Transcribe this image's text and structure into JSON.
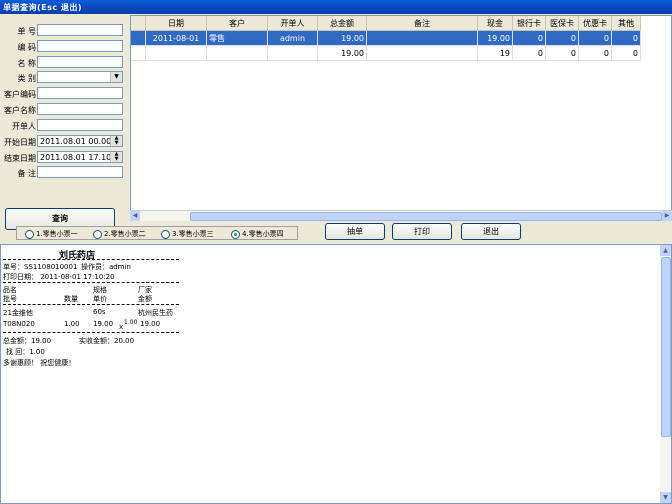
{
  "window": {
    "title": "单据查询(Esc 退出)"
  },
  "filters": {
    "fields": [
      {
        "label": "单 号",
        "value": ""
      },
      {
        "label": "编 码",
        "value": ""
      },
      {
        "label": "名 称",
        "value": ""
      },
      {
        "label": "类 别",
        "value": ""
      },
      {
        "label": "客户编码",
        "value": ""
      },
      {
        "label": "客户名称",
        "value": ""
      },
      {
        "label": "开单人",
        "value": ""
      },
      {
        "label": "开始日期",
        "value": "2011.08.01 00.00"
      },
      {
        "label": "结束日期",
        "value": "2011.08.01 17.10"
      },
      {
        "label": "备 注",
        "value": ""
      }
    ],
    "query_label": "查询"
  },
  "grid": {
    "columns": [
      "日期",
      "客户",
      "开单人",
      "总金额",
      "备注",
      "现金",
      "银行卡",
      "医保卡",
      "优惠卡",
      "其他"
    ],
    "rows": [
      [
        "2011-08-01",
        "零售",
        "admin",
        "19.00",
        "",
        "19.00",
        "0",
        "0",
        "0",
        "0"
      ],
      [
        "",
        "",
        "",
        "19.00",
        "",
        "19",
        "0",
        "0",
        "0",
        "0"
      ]
    ]
  },
  "print_options": {
    "radios": [
      "1.零售小票一",
      "2.零售小票二",
      "3.零售小票三",
      "4.零售小票四"
    ],
    "selected_index": 3,
    "buttons": {
      "extract": "抽单",
      "print": "打印",
      "exit": "退出"
    }
  },
  "receipt": {
    "store": "刘氏药店",
    "order_no": "单号：SS1108010001",
    "operator": "操作员：admin",
    "print_date": "打印日期： 2011-08-01 17:10:20",
    "hdr1": {
      "name": "品名",
      "spec": "规格",
      "maker": "厂家"
    },
    "hdr2": {
      "batch": "批号",
      "qty": "数量",
      "price": "单价",
      "amount": "金额"
    },
    "item": {
      "name": "21金维他",
      "spec": "60s",
      "maker": "杭州民生药",
      "batch": "T08N020",
      "qty": "1.00",
      "price": "19.00",
      "x": "x",
      "mult": "1.00",
      "amount": "19.00"
    },
    "total": "总金额：19.00",
    "received": "实收金额：20.00",
    "change": "找 回：1.00",
    "thanks": "多谢惠顾！ 祝您健康！"
  }
}
